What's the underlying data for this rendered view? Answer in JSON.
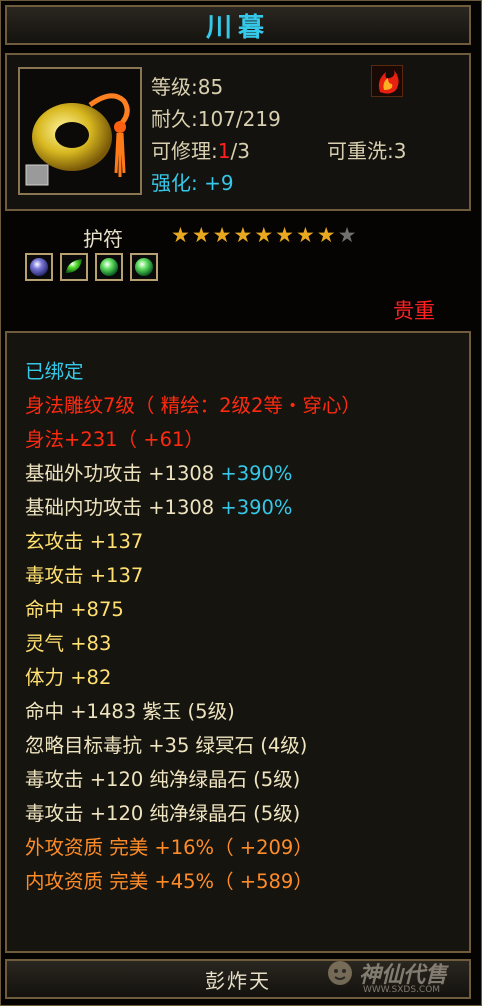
{
  "item": {
    "name": "川暮",
    "level": "等级:85",
    "durability": "耐久:107/219",
    "repair_prefix": "可修理:",
    "repair_used": "1",
    "repair_suffix": "/3",
    "rewash": "可重洗:3",
    "enhance": "强化: +9"
  },
  "charm": {
    "label": "护符",
    "stars_total": 9,
    "stars_filled": 8,
    "gems": [
      "purple-gem",
      "green-leaf-gem",
      "green-gem",
      "green-gem"
    ]
  },
  "rarity": "贵重",
  "attributes": [
    {
      "text": "已绑定",
      "color": "cyan"
    },
    {
      "text": "身法雕纹7级（ 精绘：2级2等・穿心）",
      "color": "red"
    },
    {
      "text": "身法+231（ +61）",
      "color": "red"
    },
    {
      "text": "基础外功攻击 +1308",
      "extra": " +390%",
      "color": "white"
    },
    {
      "text": "基础内功攻击 +1308",
      "extra": " +390%",
      "color": "white"
    },
    {
      "text": "玄攻击 +137",
      "color": "yellow"
    },
    {
      "text": "毒攻击 +137",
      "color": "yellow"
    },
    {
      "text": "命中 +875",
      "color": "yellow"
    },
    {
      "text": "灵气 +83",
      "color": "yellow"
    },
    {
      "text": "体力 +82",
      "color": "yellow"
    },
    {
      "text": "命中 +1483 紫玉 (5级)",
      "color": "white"
    },
    {
      "text": "忽略目标毒抗 +35 绿冥石 (4级)",
      "color": "white"
    },
    {
      "text": "毒攻击 +120 纯净绿晶石 (5级)",
      "color": "white"
    },
    {
      "text": "毒攻击 +120 纯净绿晶石 (5级)",
      "color": "white"
    },
    {
      "text": "外攻资质  完美 +16%（ +209）",
      "color": "orange"
    },
    {
      "text": "内攻资质  完美 +45%（ +589）",
      "color": "orange"
    }
  ],
  "footer": "彭炸天",
  "watermark": {
    "text": "神仙代售",
    "url": "WWW.SXDS.COM"
  },
  "colors": {
    "cyan": "#35c8e8",
    "red": "#ff2a10",
    "white": "#efe4c0",
    "yellow": "#ffe070",
    "orange": "#ff8c28",
    "frame": "#6e5c3c"
  }
}
